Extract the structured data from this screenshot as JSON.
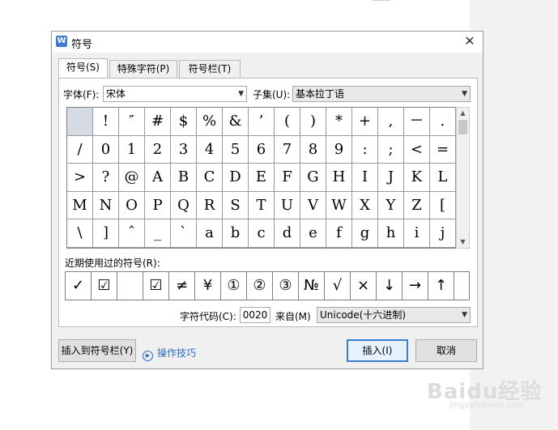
{
  "title": "符号",
  "app_icon_letter": "W",
  "tabs": [
    "符号(S)",
    "特殊字符(P)",
    "符号栏(T)"
  ],
  "font": {
    "label": "字体(F):",
    "value": "宋体"
  },
  "subset": {
    "label": "子集(U):",
    "value": "基本拉丁语"
  },
  "grid_symbols": [
    " ",
    "!",
    "″",
    "#",
    "$",
    "%",
    "&",
    "’",
    "(",
    ")",
    "*",
    "+",
    ",",
    "－",
    ".",
    "/",
    "0",
    "1",
    "2",
    "3",
    "4",
    "5",
    "6",
    "7",
    "8",
    "9",
    ":",
    ";",
    "<",
    "=",
    ">",
    "?",
    "@",
    "A",
    "B",
    "C",
    "D",
    "E",
    "F",
    "G",
    "H",
    "I",
    "J",
    "K",
    "L",
    "M",
    "N",
    "O",
    "P",
    "Q",
    "R",
    "S",
    "T",
    "U",
    "V",
    "W",
    "X",
    "Y",
    "Z",
    "[",
    "\\",
    "]",
    "ˆ",
    "_",
    "ˋ",
    "a",
    "b",
    "c",
    "d",
    "e",
    "f",
    "g",
    "h",
    "i",
    "j"
  ],
  "recent": {
    "label": "近期使用过的符号(R):",
    "symbols": [
      "✓",
      "☑",
      "",
      "☑",
      "≠",
      "¥",
      "①",
      "②",
      "③",
      "№",
      "√",
      "×",
      "↓",
      "→",
      "↑"
    ]
  },
  "char_code": {
    "label": "字符代码(C):",
    "value": "0020"
  },
  "from": {
    "label": "来自(M)",
    "value": "Unicode(十六进制)"
  },
  "buttons": {
    "insert_to_bar": "插入到符号栏(Y)",
    "insert": "插入(I)",
    "cancel": "取消"
  },
  "tips_link": "操作技巧",
  "watermark": "Baidu经验",
  "watermark_sub": "jingyan.baidu.com",
  "colors": {
    "accent": "#3c7fd1",
    "link": "#2b6cc4",
    "selected_cell": "#d5dbe3"
  }
}
